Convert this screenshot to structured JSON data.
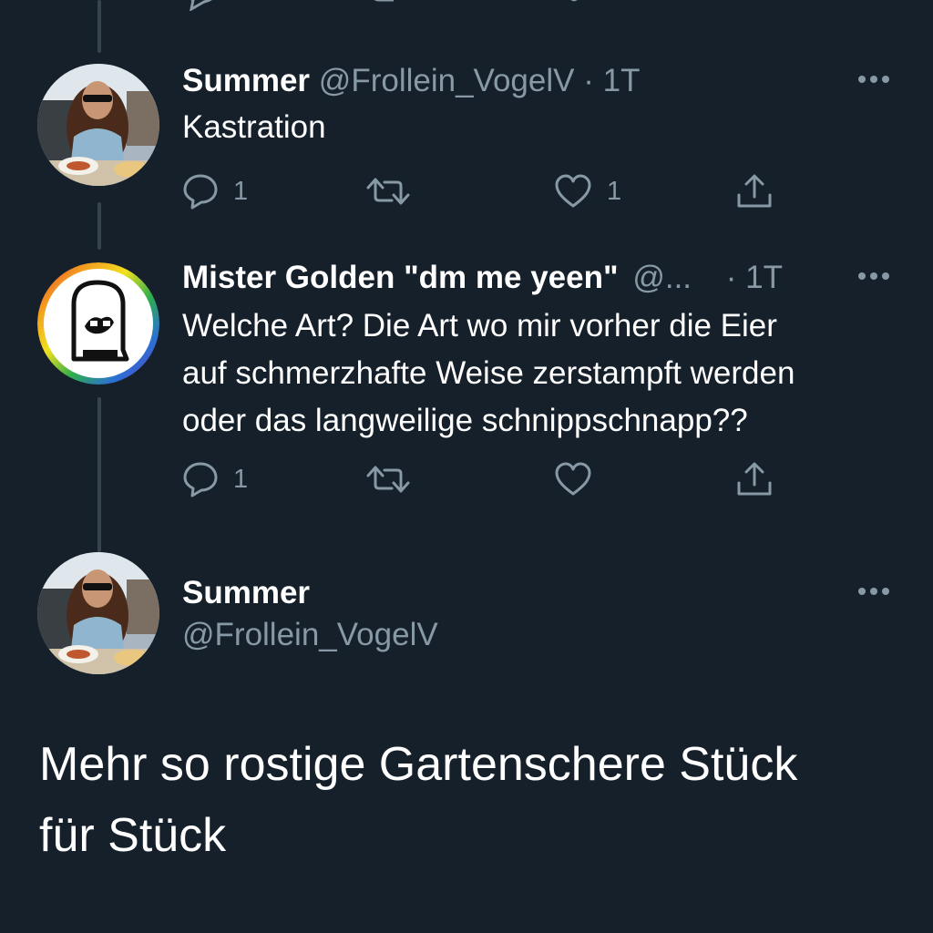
{
  "tweets": [
    {
      "name": "Summer",
      "handle": "@Frollein_VogelV",
      "separator": "·",
      "time": "1T",
      "text": "Kastration",
      "reply_count": "1",
      "retweet_count": "",
      "like_count": "1"
    },
    {
      "name": "Mister Golden \"dm me yeen\"",
      "handle": "@...",
      "separator": "·",
      "time": "1T",
      "text_lines": [
        "Welche Art? Die Art wo mir vorher die Eier",
        "auf schmerzhafte Weise zerstampft werden",
        "oder das langweilige schnippschnapp??"
      ],
      "reply_count": "1",
      "retweet_count": "",
      "like_count": ""
    }
  ],
  "main_tweet": {
    "name": "Summer",
    "handle": "@Frollein_VogelV",
    "text_lines": [
      "Mehr so rostige Gartenschere Stück",
      "für Stück"
    ]
  },
  "icons": {
    "reply": "reply-icon",
    "retweet": "retweet-icon",
    "like": "heart-icon",
    "share": "share-icon",
    "more": "more-icon"
  },
  "colors": {
    "background": "#15202b",
    "primary_text": "#ffffff",
    "secondary_text": "#8899a6",
    "thread_line": "#38444d"
  }
}
